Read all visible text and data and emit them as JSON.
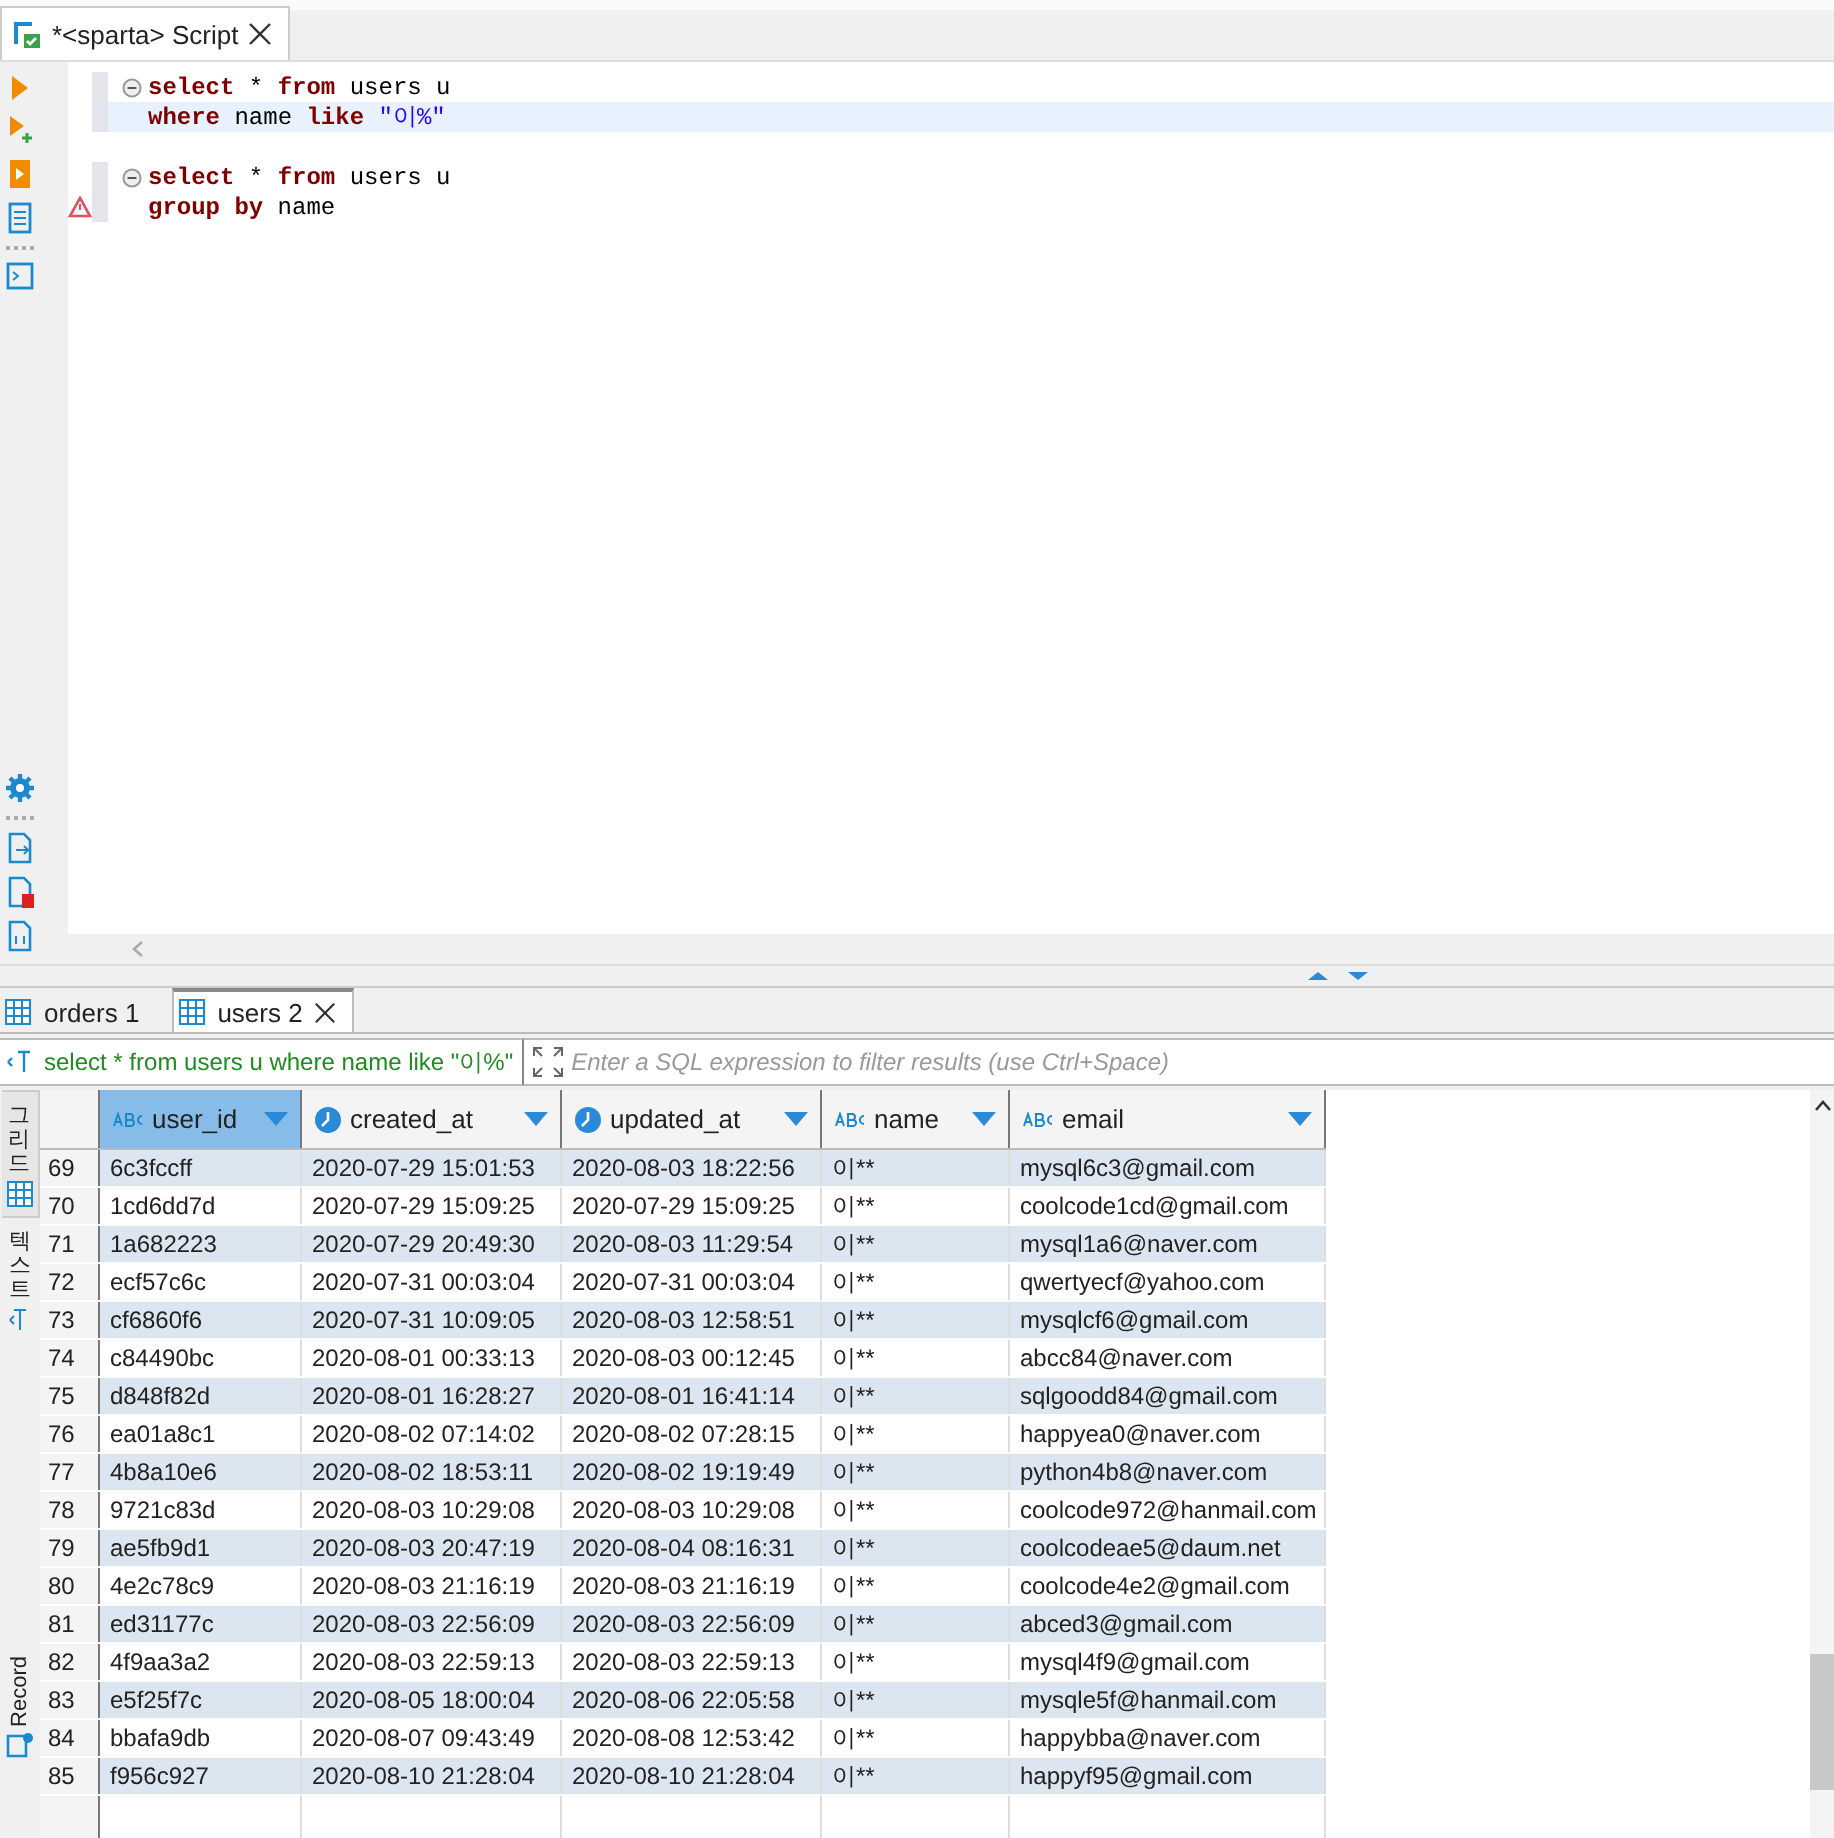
{
  "editor_tab": {
    "title": "*<sparta> Script"
  },
  "editor_blocks": [
    {
      "expanded": true,
      "lines": [
        {
          "current": false,
          "warning": false,
          "tokens": [
            {
              "kind": "keyword",
              "text": "select"
            },
            {
              "kind": "plain",
              "text": " * "
            },
            {
              "kind": "keyword",
              "text": "from"
            },
            {
              "kind": "plain",
              "text": " users u"
            }
          ]
        },
        {
          "current": true,
          "warning": false,
          "tokens": [
            {
              "kind": "keyword",
              "text": "where"
            },
            {
              "kind": "plain",
              "text": " name "
            },
            {
              "kind": "keyword",
              "text": "like"
            },
            {
              "kind": "string",
              "text": " \"이%\""
            }
          ]
        }
      ]
    },
    {
      "expanded": true,
      "lines": [
        {
          "current": false,
          "warning": false,
          "tokens": [
            {
              "kind": "keyword",
              "text": "select"
            },
            {
              "kind": "plain",
              "text": " * "
            },
            {
              "kind": "keyword",
              "text": "from"
            },
            {
              "kind": "plain",
              "text": " users u"
            }
          ]
        },
        {
          "current": false,
          "warning": true,
          "tokens": [
            {
              "kind": "keyword",
              "text": "group by"
            },
            {
              "kind": "plain",
              "text": " name"
            }
          ]
        }
      ]
    }
  ],
  "result_tabs": [
    {
      "label": "orders 1",
      "selected": false,
      "closable": false
    },
    {
      "label": "users 2",
      "selected": true,
      "closable": true
    }
  ],
  "filter": {
    "query": "select * from users u where name like \"이%\"",
    "placeholder": "Enter a SQL expression to filter results (use Ctrl+Space)"
  },
  "side_tabs": [
    {
      "label": "그리드",
      "selected": true
    },
    {
      "label": "텍스트",
      "selected": false
    }
  ],
  "record_label": "Record",
  "table": {
    "columns": [
      {
        "name": "user_id",
        "kind": "text",
        "selected": true
      },
      {
        "name": "created_at",
        "kind": "time",
        "selected": false
      },
      {
        "name": "updated_at",
        "kind": "time",
        "selected": false
      },
      {
        "name": "name",
        "kind": "text",
        "selected": false
      },
      {
        "name": "email",
        "kind": "text",
        "selected": false
      }
    ],
    "rows": [
      {
        "number": "69",
        "cells": [
          "6c3fccff",
          "2020-07-29 15:01:53",
          "2020-08-03 18:22:56",
          "이**",
          "mysql6c3@gmail.com"
        ]
      },
      {
        "number": "70",
        "cells": [
          "1cd6dd7d",
          "2020-07-29 15:09:25",
          "2020-07-29 15:09:25",
          "이**",
          "coolcode1cd@gmail.com"
        ]
      },
      {
        "number": "71",
        "cells": [
          "1a682223",
          "2020-07-29 20:49:30",
          "2020-08-03 11:29:54",
          "이**",
          "mysql1a6@naver.com"
        ]
      },
      {
        "number": "72",
        "cells": [
          "ecf57c6c",
          "2020-07-31 00:03:04",
          "2020-07-31 00:03:04",
          "이**",
          "qwertyecf@yahoo.com"
        ]
      },
      {
        "number": "73",
        "cells": [
          "cf6860f6",
          "2020-07-31 10:09:05",
          "2020-08-03 12:58:51",
          "이**",
          "mysqlcf6@gmail.com"
        ]
      },
      {
        "number": "74",
        "cells": [
          "c84490bc",
          "2020-08-01 00:33:13",
          "2020-08-03 00:12:45",
          "이**",
          "abcc84@naver.com"
        ]
      },
      {
        "number": "75",
        "cells": [
          "d848f82d",
          "2020-08-01 16:28:27",
          "2020-08-01 16:41:14",
          "이**",
          "sqlgoodd84@gmail.com"
        ]
      },
      {
        "number": "76",
        "cells": [
          "ea01a8c1",
          "2020-08-02 07:14:02",
          "2020-08-02 07:28:15",
          "이**",
          "happyea0@naver.com"
        ]
      },
      {
        "number": "77",
        "cells": [
          "4b8a10e6",
          "2020-08-02 18:53:11",
          "2020-08-02 19:19:49",
          "이**",
          "python4b8@naver.com"
        ]
      },
      {
        "number": "78",
        "cells": [
          "9721c83d",
          "2020-08-03 10:29:08",
          "2020-08-03 10:29:08",
          "이**",
          "coolcode972@hanmail.com"
        ]
      },
      {
        "number": "79",
        "cells": [
          "ae5fb9d1",
          "2020-08-03 20:47:19",
          "2020-08-04 08:16:31",
          "이**",
          "coolcodeae5@daum.net"
        ]
      },
      {
        "number": "80",
        "cells": [
          "4e2c78c9",
          "2020-08-03 21:16:19",
          "2020-08-03 21:16:19",
          "이**",
          "coolcode4e2@gmail.com"
        ]
      },
      {
        "number": "81",
        "cells": [
          "ed31177c",
          "2020-08-03 22:56:09",
          "2020-08-03 22:56:09",
          "이**",
          "abced3@gmail.com"
        ]
      },
      {
        "number": "82",
        "cells": [
          "4f9aa3a2",
          "2020-08-03 22:59:13",
          "2020-08-03 22:59:13",
          "이**",
          "mysql4f9@gmail.com"
        ]
      },
      {
        "number": "83",
        "cells": [
          "e5f25f7c",
          "2020-08-05 18:00:04",
          "2020-08-06 22:05:58",
          "이**",
          "mysqle5f@hanmail.com"
        ]
      },
      {
        "number": "84",
        "cells": [
          "bbafa9db",
          "2020-08-07 09:43:49",
          "2020-08-08 12:53:42",
          "이**",
          "happybba@naver.com"
        ]
      },
      {
        "number": "85",
        "cells": [
          "f956c927",
          "2020-08-10 21:28:04",
          "2020-08-10 21:28:04",
          "이**",
          "happyf95@gmail.com"
        ]
      }
    ]
  }
}
